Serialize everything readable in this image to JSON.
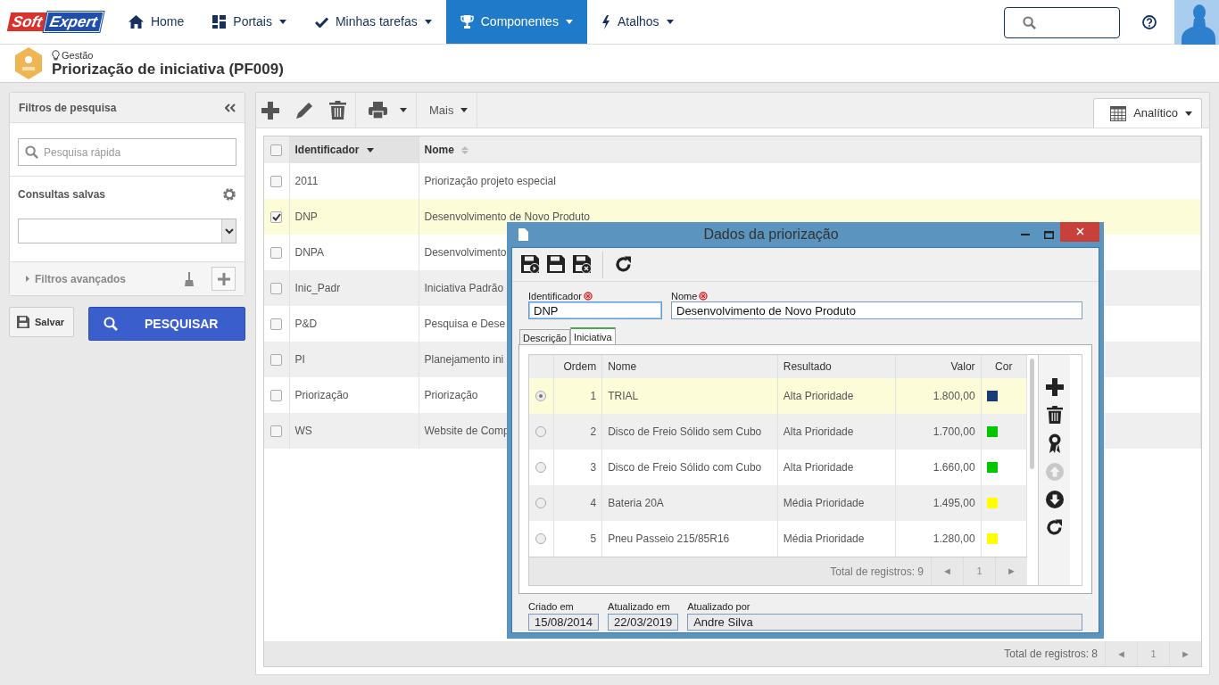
{
  "navbar": {
    "logo": [
      "Soft",
      "Expert"
    ],
    "items": [
      {
        "label": "Home",
        "dropdown": false,
        "selected": false
      },
      {
        "label": "Portais",
        "dropdown": true,
        "selected": false
      },
      {
        "label": "Minhas tarefas",
        "dropdown": true,
        "selected": false
      },
      {
        "label": "Componentes",
        "dropdown": true,
        "selected": true
      },
      {
        "label": "Atalhos",
        "dropdown": true,
        "selected": false
      }
    ]
  },
  "header": {
    "module": "Gestão",
    "title": "Priorização de iniciativa (PF009)"
  },
  "filters": {
    "title": "Filtros de pesquisa",
    "search_placeholder": "Pesquisa rápida",
    "saved_label": "Consultas salvas",
    "advanced": "Filtros avançados",
    "save_button": "Salvar",
    "search_button": "PESQUISAR"
  },
  "toolbar": {
    "more": "Mais",
    "view": "Analítico"
  },
  "table": {
    "all_checked": false,
    "columns": [
      {
        "label": "Identificador",
        "sorted": true
      },
      {
        "label": "Nome",
        "sorted": false
      }
    ],
    "rows": [
      {
        "id": "2011",
        "name": "Priorização projeto especial",
        "checked": false,
        "selected": false
      },
      {
        "id": "DNP",
        "name": "Desenvolvimento de Novo Produto",
        "checked": true,
        "selected": true
      },
      {
        "id": "DNPA",
        "name": "Desenvolvimento",
        "checked": false,
        "selected": false
      },
      {
        "id": "Inic_Padr",
        "name": "Iniciativa Padrão",
        "checked": false,
        "selected": false
      },
      {
        "id": "P&D",
        "name": "Pesquisa e Dese",
        "checked": false,
        "selected": false
      },
      {
        "id": "PI",
        "name": "Planejamento ini",
        "checked": false,
        "selected": false
      },
      {
        "id": "Priorização",
        "name": "Priorização",
        "checked": false,
        "selected": false
      },
      {
        "id": "WS",
        "name": "Website de Comp",
        "checked": false,
        "selected": false
      }
    ],
    "total": "Total de registros: 8",
    "prev": "◄",
    "page": "1",
    "next": "►"
  },
  "dialog": {
    "title": "Dados da priorização",
    "fields": [
      {
        "label": "Identificador",
        "value": "DNP",
        "required": true
      },
      {
        "label": "Nome",
        "value": "Desenvolvimento de Novo Produto",
        "required": true
      }
    ],
    "tabs": [
      {
        "label": "Descrição",
        "selected": false
      },
      {
        "label": "Iniciativa",
        "selected": true
      }
    ],
    "grid": {
      "columns": [
        "Ordem",
        "Nome",
        "Resultado",
        "Valor",
        "Cor"
      ],
      "rows": [
        {
          "order": "1",
          "name": "TRIAL",
          "result": "Alta Prioridade",
          "value": "1.800,00",
          "color": "#1a3a78",
          "selected": true
        },
        {
          "order": "2",
          "name": "Disco de Freio Sólido sem Cubo",
          "result": "Alta Prioridade",
          "value": "1.700,00",
          "color": "#00c800",
          "selected": false
        },
        {
          "order": "3",
          "name": "Disco de Freio Sólido com Cubo",
          "result": "Alta Prioridade",
          "value": "1.660,00",
          "color": "#00c800",
          "selected": false
        },
        {
          "order": "4",
          "name": "Bateria 20A",
          "result": "Média Prioridade",
          "value": "1.495,00",
          "color": "#ffff00",
          "selected": false
        },
        {
          "order": "5",
          "name": "Pneu Passeio 215/85R16",
          "result": "Média Prioridade",
          "value": "1.280,00",
          "color": "#ffff00",
          "selected": false
        }
      ],
      "total": "Total de registros: 9",
      "prev": "◄",
      "page": "1",
      "next": "►",
      "actions": [
        {
          "disabled": false
        },
        {
          "disabled": false
        },
        {
          "disabled": false
        },
        {
          "disabled": true
        },
        {
          "disabled": false
        },
        {
          "disabled": false
        }
      ]
    },
    "footer": [
      {
        "label": "Criado em",
        "value": "15/08/2014"
      },
      {
        "label": "Atualizado em",
        "value": "22/03/2019"
      },
      {
        "label": "Atualizado por",
        "value": "Andre Silva"
      }
    ]
  }
}
